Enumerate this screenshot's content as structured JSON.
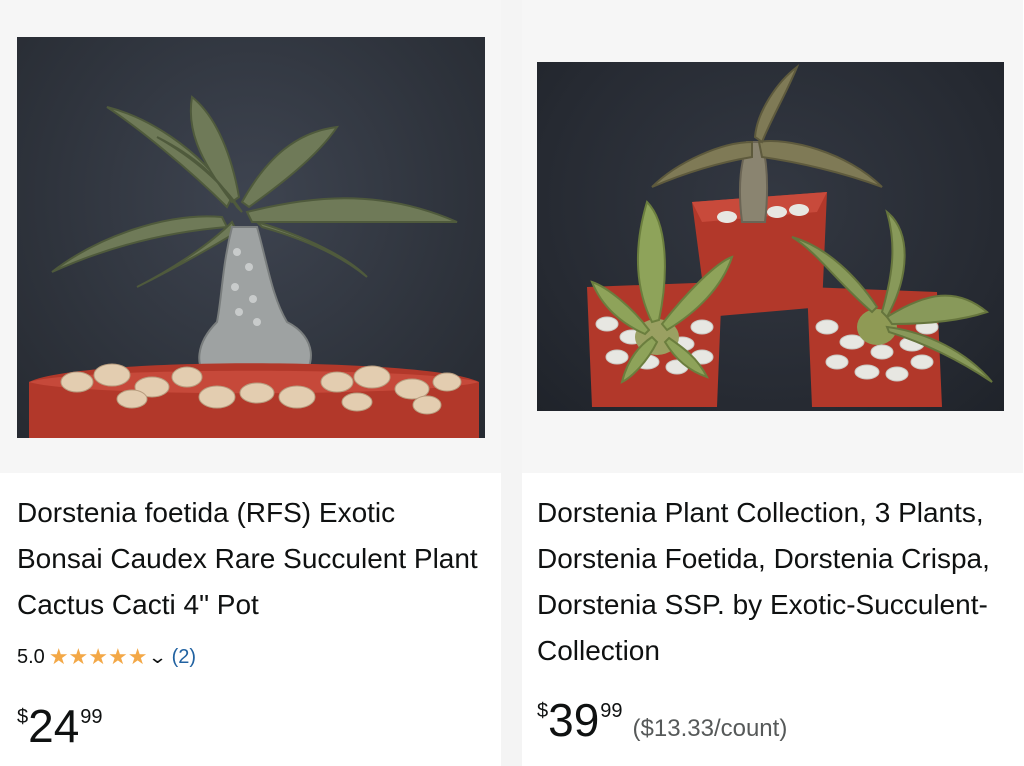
{
  "products": [
    {
      "title": "Dorstenia foetida (RFS) Exotic Bonsai Caudex Rare Succulent Plant Cactus Cacti 4\" Pot",
      "rating": "5.0",
      "stars": 5,
      "review_count": "(2)",
      "price": {
        "currency": "$",
        "whole": "24",
        "fraction": "99"
      },
      "image_alt": "Dorstenia foetida in red pot"
    },
    {
      "title": "Dorstenia Plant Collection, 3 Plants, Dorstenia Foetida, Dorstenia Crispa, Dorstenia SSP. by Exotic-Succulent-Collection",
      "price": {
        "currency": "$",
        "whole": "39",
        "fraction": "99"
      },
      "unit_price": "($13.33/count)",
      "image_alt": "Three Dorstenia plants in red pots"
    }
  ],
  "colors": {
    "star": "#f3a847",
    "link": "#2162a1",
    "text": "#0f1111",
    "muted": "#565959",
    "pot": "#b2382a"
  },
  "icons": {
    "star": "star-icon",
    "chevron": "chevron-down-icon"
  }
}
